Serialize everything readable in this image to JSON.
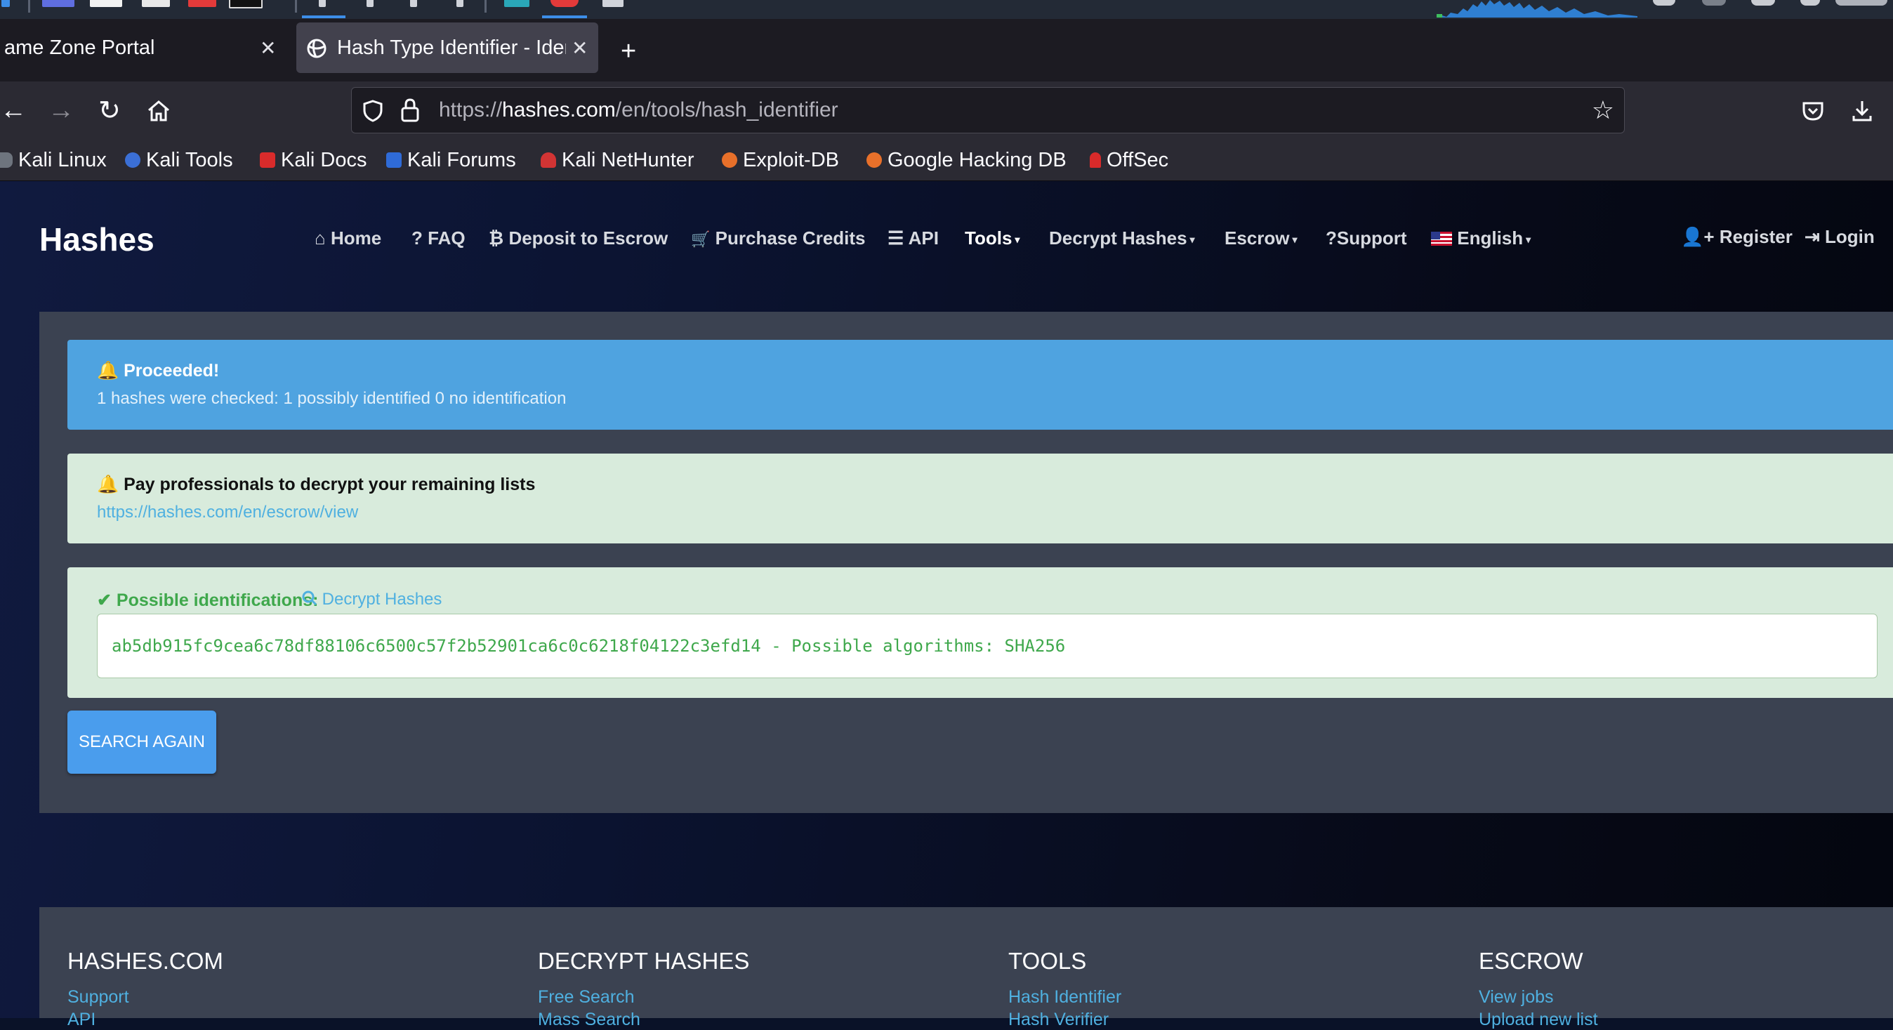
{
  "tabs": [
    {
      "title": "ame Zone Portal",
      "active": false
    },
    {
      "title": "Hash Type Identifier - Ider",
      "active": true
    }
  ],
  "address_bar": {
    "url_prefix": "https://",
    "url_host": "hashes.com",
    "url_path": "/en/tools/hash_identifier"
  },
  "bookmarks": [
    {
      "label": "Kali Linux",
      "icon": "kali-dragon-icon"
    },
    {
      "label": "Kali Tools",
      "icon": "kali-tools-icon"
    },
    {
      "label": "Kali Docs",
      "icon": "kali-docs-icon"
    },
    {
      "label": "Kali Forums",
      "icon": "kali-forums-icon"
    },
    {
      "label": "Kali NetHunter",
      "icon": "nethunter-icon"
    },
    {
      "label": "Exploit-DB",
      "icon": "exploit-db-icon"
    },
    {
      "label": "Google Hacking DB",
      "icon": "ghdb-icon"
    },
    {
      "label": "OffSec",
      "icon": "offsec-icon"
    }
  ],
  "site": {
    "brand": "Hashes",
    "menu": [
      {
        "label": "Home",
        "icon": "home-icon",
        "glyph": "⌂",
        "dropdown": false
      },
      {
        "label": "FAQ",
        "icon": "question-icon",
        "glyph": "?",
        "dropdown": false
      },
      {
        "label": "Deposit to Escrow",
        "icon": "bitcoin-icon",
        "glyph": "₿",
        "dropdown": false
      },
      {
        "label": "Purchase Credits",
        "icon": "cart-icon",
        "glyph": "🛒",
        "dropdown": false
      },
      {
        "label": "API",
        "icon": "list-icon",
        "glyph": "☰",
        "dropdown": false
      },
      {
        "label": "Tools",
        "icon": "",
        "glyph": "",
        "dropdown": true
      },
      {
        "label": "Decrypt Hashes",
        "icon": "",
        "glyph": "",
        "dropdown": true
      },
      {
        "label": "Escrow",
        "icon": "",
        "glyph": "",
        "dropdown": true
      },
      {
        "label": "?Support",
        "icon": "",
        "glyph": "",
        "dropdown": false
      },
      {
        "label": "English",
        "icon": "us-flag-icon",
        "glyph": "",
        "dropdown": true
      }
    ],
    "auth": {
      "register": "Register",
      "login": "Login"
    }
  },
  "alerts": {
    "proceeded": {
      "title": "Proceeded!",
      "message": "1 hashes were checked: 1 possibly identified 0 no identification"
    },
    "pay": {
      "title": "Pay professionals to decrypt your remaining lists",
      "link": "https://hashes.com/en/escrow/view"
    },
    "identification": {
      "title": "Possible identifications:",
      "link": "Decrypt Hashes",
      "result": "ab5db915fc9cea6c78df88106c6500c57f2b52901ca6c0c6218f04122c3efd14 - Possible algorithms: SHA256"
    }
  },
  "search_again": "SEARCH AGAIN",
  "footer": {
    "columns": [
      {
        "title": "HASHES.COM",
        "links": [
          "Support",
          "API"
        ]
      },
      {
        "title": "DECRYPT HASHES",
        "links": [
          "Free Search",
          "Mass Search"
        ]
      },
      {
        "title": "TOOLS",
        "links": [
          "Hash Identifier",
          "Hash Verifier"
        ]
      },
      {
        "title": "ESCROW",
        "links": [
          "View jobs",
          "Upload new list"
        ]
      }
    ]
  },
  "colors": {
    "info_alert": "#4fa3e0",
    "success_bg": "#d8ebdc",
    "success_text": "#3fa84c",
    "link": "#4fb0e0",
    "button": "#4a9ded",
    "panel": "#3b4251"
  }
}
